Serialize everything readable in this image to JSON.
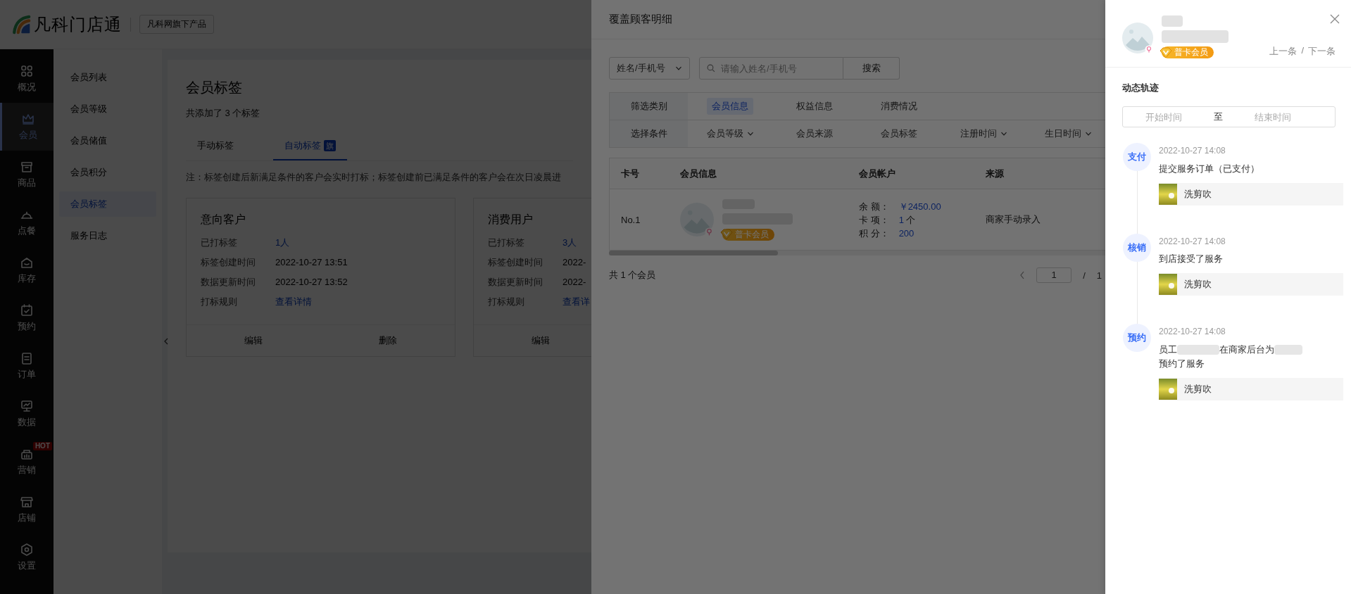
{
  "header": {
    "logo_text": "凡科门店通",
    "product_badge": "凡科网旗下产品"
  },
  "nav": {
    "items": [
      {
        "label": "概况",
        "selected": false
      },
      {
        "label": "会员",
        "selected": true
      },
      {
        "label": "商品",
        "selected": false
      },
      {
        "label": "点餐",
        "selected": false
      },
      {
        "label": "库存",
        "selected": false
      },
      {
        "label": "预约",
        "selected": false
      },
      {
        "label": "订单",
        "selected": false
      },
      {
        "label": "数据",
        "selected": false
      },
      {
        "label": "营销",
        "selected": false,
        "badge": "HOT"
      },
      {
        "label": "店铺",
        "selected": false
      },
      {
        "label": "设置",
        "selected": false
      }
    ]
  },
  "submenu": {
    "items": [
      {
        "label": "会员列表",
        "selected": false
      },
      {
        "label": "会员等级",
        "selected": false
      },
      {
        "label": "会员储值",
        "selected": false
      },
      {
        "label": "会员积分",
        "selected": false
      },
      {
        "label": "会员标签",
        "selected": true
      },
      {
        "label": "服务日志",
        "selected": false
      }
    ]
  },
  "content": {
    "title": "会员标签",
    "summary": "共添加了 3 个标签",
    "tabs": [
      {
        "label": "手动标签",
        "selected": false
      },
      {
        "label": "自动标签",
        "badge": "旗",
        "selected": true
      }
    ],
    "note": "注：标签创建后新满足条件的客户会实时打标；标签创建前已满足条件的客户会在次日凌晨进",
    "cards": [
      {
        "name": "意向客户",
        "rows": [
          {
            "label": "已打标签",
            "value": "1人",
            "kind": "link"
          },
          {
            "label": "标签创建时间",
            "value": "2022-10-27 13:51",
            "kind": "text"
          },
          {
            "label": "数据更新时间",
            "value": "2022-10-27 13:52",
            "kind": "text"
          },
          {
            "label": "打标规则",
            "value": "查看详情",
            "kind": "link"
          }
        ],
        "actions": [
          "编辑",
          "删除"
        ]
      },
      {
        "name": "消费用户",
        "rows": [
          {
            "label": "已打标签",
            "value": "3人",
            "kind": "link"
          },
          {
            "label": "标签创建时间",
            "value": "2022-",
            "kind": "text"
          },
          {
            "label": "数据更新时间",
            "value": "2022-",
            "kind": "text"
          },
          {
            "label": "打标规则",
            "value": "查看详",
            "kind": "link"
          }
        ],
        "actions": [
          "编辑"
        ]
      }
    ]
  },
  "modal": {
    "title": "覆盖顾客明细",
    "search": {
      "field_select": "姓名/手机号",
      "placeholder": "请输入姓名/手机号",
      "button": "搜索"
    },
    "filters": [
      {
        "label": "筛选类别",
        "options": [
          {
            "label": "会员信息",
            "selected": true,
            "dropdown": false
          },
          {
            "label": "权益信息",
            "selected": false,
            "dropdown": false
          },
          {
            "label": "消费情况",
            "selected": false,
            "dropdown": false
          }
        ]
      },
      {
        "label": "选择条件",
        "options": [
          {
            "label": "会员等级",
            "selected": false,
            "dropdown": true
          },
          {
            "label": "会员来源",
            "selected": false,
            "dropdown": false
          },
          {
            "label": "会员标签",
            "selected": false,
            "dropdown": false
          },
          {
            "label": "注册时间",
            "selected": false,
            "dropdown": true
          },
          {
            "label": "生日时间",
            "selected": false,
            "dropdown": true
          }
        ]
      }
    ],
    "table": {
      "columns": [
        "卡号",
        "会员信息",
        "会员帐户",
        "来源"
      ],
      "rows": [
        {
          "card_no": "No.1",
          "member_level": "普卡会员",
          "account": [
            {
              "label": "余 额：",
              "value": "￥2450.00"
            },
            {
              "label": "卡 项：",
              "value": "1",
              "unit": "个"
            },
            {
              "label": "积 分：",
              "value": "200"
            }
          ],
          "source": "商家手动录入"
        }
      ]
    },
    "footer": {
      "total": "共 1 个会员",
      "page": "1",
      "separator": "/",
      "pages": "1"
    }
  },
  "drawer": {
    "member_level": "普卡会员",
    "prev": "上一条",
    "separator": "/",
    "next": "下一条",
    "section_title": "动态轨迹",
    "date_range": {
      "start_placeholder": "开始时间",
      "separator": "至",
      "end_placeholder": "结束时间"
    },
    "events": [
      {
        "type_label": "支付",
        "time": "2022-10-27 14:08",
        "description": [
          "提交服务订单（已支付）"
        ],
        "service": "洗剪吹"
      },
      {
        "type_label": "核销",
        "time": "2022-10-27 14:08",
        "description": [
          "到店接受了服务"
        ],
        "service": "洗剪吹"
      },
      {
        "type_label": "预约",
        "time": "2022-10-27 14:08",
        "description": [
          "员工",
          "在商家后台为",
          "预约了服务"
        ],
        "service": "洗剪吹"
      }
    ]
  }
}
